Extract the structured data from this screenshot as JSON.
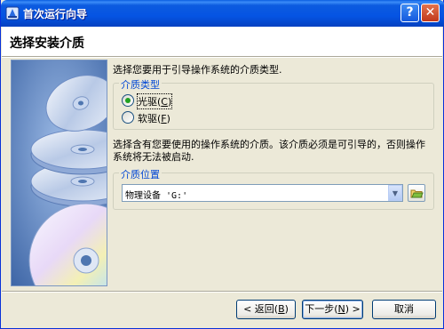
{
  "window": {
    "title": "首次运行向导"
  },
  "titlebar": {
    "help_label": "?",
    "close_label": "✕"
  },
  "header": {
    "title": "选择安装介质"
  },
  "intro_text": "选择您要用于引导操作系统的介质类型.",
  "media_type_group": {
    "title": "介质类型",
    "options": [
      {
        "label": "光驱",
        "shortcut": "C",
        "selected": true
      },
      {
        "label": "软驱",
        "shortcut": "F",
        "selected": false
      }
    ]
  },
  "description_text": "选择含有您要使用的操作系统的介质。该介质必须是可引导的，否则操作系统将无法被启动.",
  "media_location_group": {
    "title": "介质位置",
    "combo_value": "物理设备 'G:'"
  },
  "buttons": {
    "back": {
      "label": "< 返回",
      "shortcut": "B"
    },
    "next": {
      "label": "下一步",
      "shortcut": "N",
      "suffix": " >"
    },
    "cancel": {
      "label": "取消"
    }
  },
  "icons": [
    "wizard-app-icon",
    "help-icon",
    "close-icon",
    "disc-stack-image",
    "dropdown-arrow-icon",
    "browse-folder-icon"
  ],
  "colors": {
    "titlebar": "#0554e3",
    "groupbox_title": "#0046d5",
    "selected_radio": "#21a121"
  }
}
